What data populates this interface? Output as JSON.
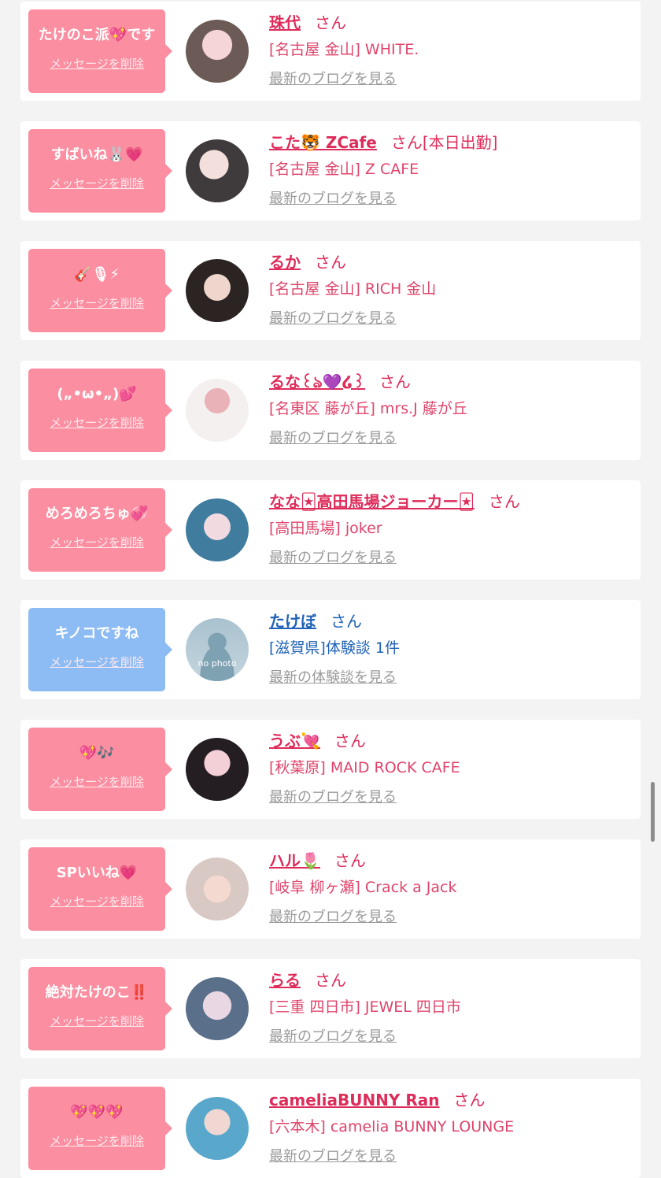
{
  "colors": {
    "pink": "#fb8ea0",
    "blue": "#8dbcf4",
    "name_pink": "#de2c5a",
    "name_blue": "#1f62b8",
    "shop_pink": "#e0446b",
    "shop_blue": "#1f62b8",
    "gray_link": "#9a9a9a"
  },
  "items": [
    {
      "message": "たけのこ派💖です",
      "delete_label": "メッセージを削除",
      "name": "珠代",
      "san": "さん",
      "suffix": "",
      "shop": "[名古屋 金山] WHITE.",
      "link": "最新のブログを見る",
      "theme": "pink",
      "avatar_icon": "avatar-photo-icon"
    },
    {
      "message": "すばいね🐰💗",
      "delete_label": "メッセージを削除",
      "name": "こた🐯 ZCafe",
      "san": "さん",
      "suffix": "[本日出勤]",
      "shop": "[名古屋 金山] Z CAFE",
      "link": "最新のブログを見る",
      "theme": "pink",
      "avatar_icon": "avatar-photo-icon"
    },
    {
      "message": "🎸🎙⚡",
      "delete_label": "メッセージを削除",
      "name": "るか",
      "san": "さん",
      "suffix": "",
      "shop": "[名古屋 金山] RICH 金山",
      "link": "最新のブログを見る",
      "theme": "pink",
      "avatar_icon": "avatar-photo-icon"
    },
    {
      "message": "(„•ω•„)💕",
      "delete_label": "メッセージを削除",
      "name": "るな꒰ঌ💜໒꒱",
      "san": "さん",
      "suffix": "",
      "shop": "[名東区 藤が丘] mrs.J 藤が丘",
      "link": "最新のブログを見る",
      "theme": "pink",
      "avatar_icon": "avatar-photo-icon"
    },
    {
      "message": "めろめろちゅ💞",
      "delete_label": "メッセージを削除",
      "name": "なな🃏高田馬場ジョーカー🃏",
      "san": "さん",
      "suffix": "",
      "shop": "[高田馬場] joker",
      "link": "最新のブログを見る",
      "theme": "pink",
      "avatar_icon": "avatar-photo-icon"
    },
    {
      "message": "キノコですね",
      "delete_label": "メッセージを削除",
      "name": "たけぼ",
      "san": "さん",
      "suffix": "",
      "shop": "[滋賀県]体験談 1件",
      "link": "最新の体験談を見る",
      "theme": "blue",
      "avatar_icon": "no-photo-icon",
      "avatar_text": "no photo"
    },
    {
      "message": "💖🎶",
      "delete_label": "メッセージを削除",
      "name": "うぶ💘",
      "san": "さん",
      "suffix": "",
      "shop": "[秋葉原] MAID ROCK CAFE",
      "link": "最新のブログを見る",
      "theme": "pink",
      "avatar_icon": "avatar-photo-icon"
    },
    {
      "message": "SPいいね💗",
      "delete_label": "メッセージを削除",
      "name": "ハル🌷",
      "san": "さん",
      "suffix": "",
      "shop": "[岐阜 柳ヶ瀬] Crack a Jack",
      "link": "最新のブログを見る",
      "theme": "pink",
      "avatar_icon": "avatar-photo-icon"
    },
    {
      "message": "絶対たけのこ‼️",
      "delete_label": "メッセージを削除",
      "name": "らる",
      "san": "さん",
      "suffix": "",
      "shop": "[三重 四日市] JEWEL 四日市",
      "link": "最新のブログを見る",
      "theme": "pink",
      "avatar_icon": "avatar-photo-icon"
    },
    {
      "message": "💖💖💖",
      "delete_label": "メッセージを削除",
      "name": "cameliaBUNNY Ran",
      "san": "さん",
      "suffix": "",
      "shop": "[六本木] camelia BUNNY LOUNGE",
      "link": "最新のブログを見る",
      "theme": "pink",
      "avatar_icon": "avatar-photo-icon"
    }
  ]
}
